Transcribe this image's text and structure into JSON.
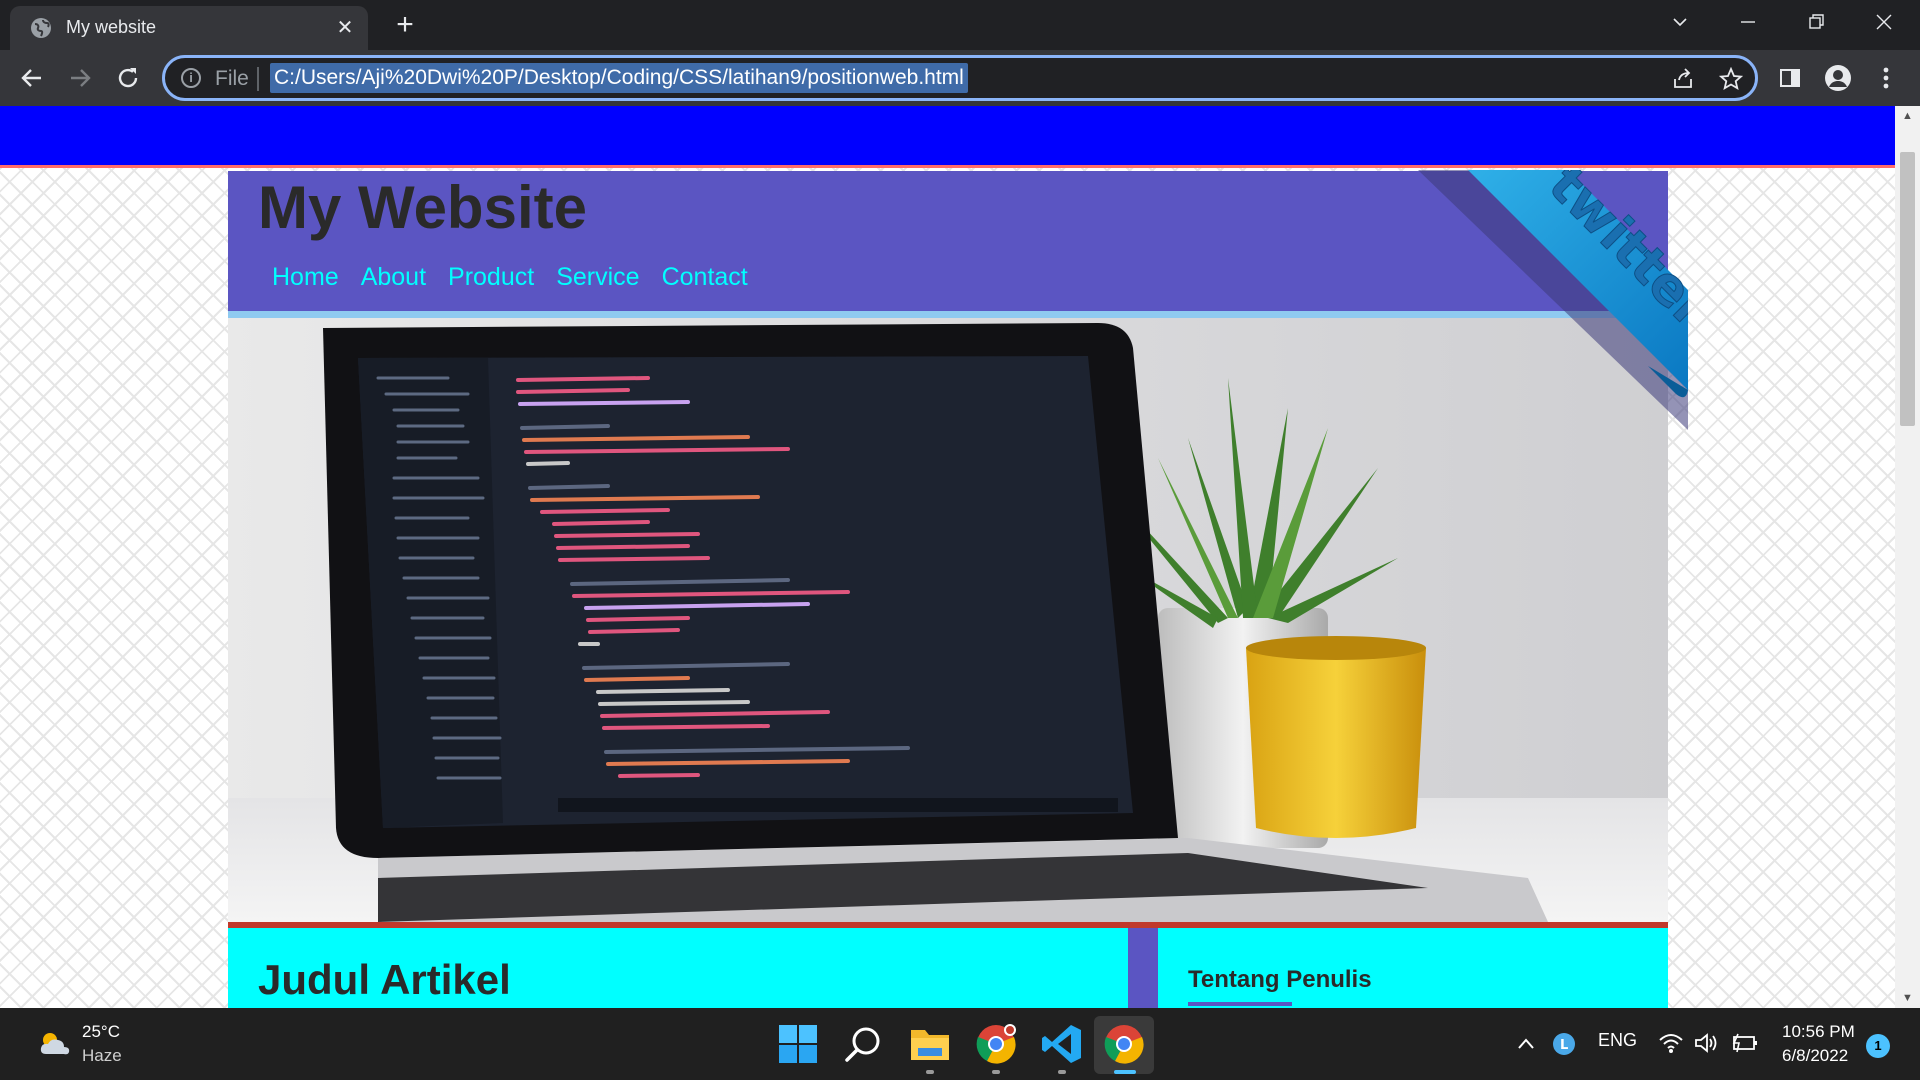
{
  "browser": {
    "tab_title": "My website",
    "tab_close": "✕",
    "new_tab": "+",
    "scheme_label": "File",
    "url": "C:/Users/Aji%20Dwi%20P/Desktop/Coding/CSS/latihan9/positionweb.html"
  },
  "page": {
    "site_title": "My Website",
    "nav": [
      "Home",
      "About",
      "Product",
      "Service",
      "Contact"
    ],
    "ribbon_text": "twitter",
    "article_title": "Judul Artikel",
    "sidebar_title": "Tentang Penulis",
    "colors": {
      "topbar": "#0000ff",
      "header": "#5b55c2",
      "nav_link": "#00ffff",
      "content_bg": "#00ffff",
      "separator": "#c0392b"
    }
  },
  "taskbar": {
    "weather_temp": "25°C",
    "weather_desc": "Haze",
    "language": "ENG",
    "time": "10:56 PM",
    "date": "6/8/2022",
    "notifications": "1"
  }
}
